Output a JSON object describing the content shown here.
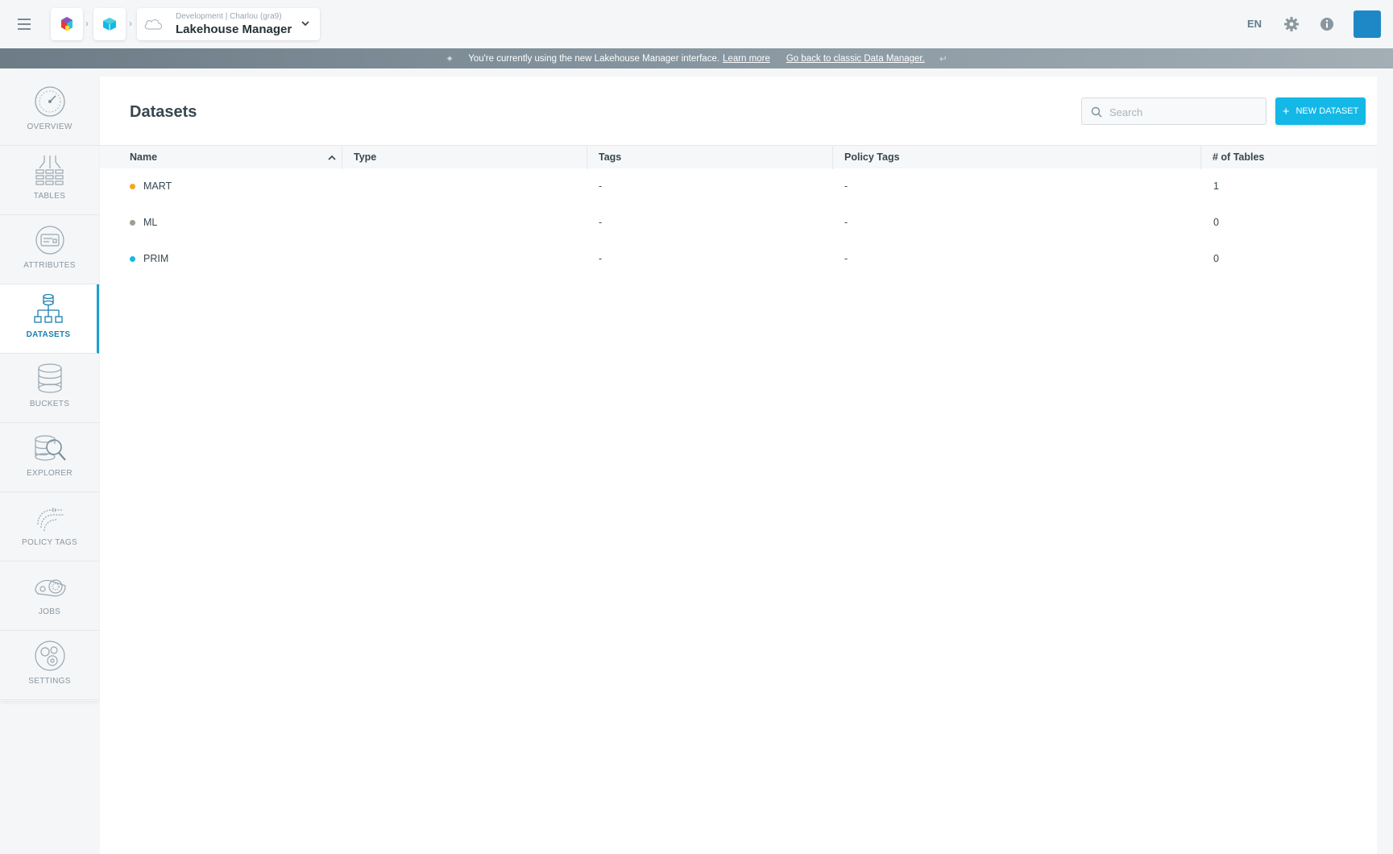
{
  "header": {
    "breadcrumb_sub": "Development | Charlou (gra9)",
    "breadcrumb_title": "Lakehouse Manager",
    "language": "EN"
  },
  "banner": {
    "message": "You're currently using the new Lakehouse Manager interface.",
    "learn_more": "Learn more",
    "go_back": "Go back to classic Data Manager."
  },
  "sidebar": {
    "items": [
      {
        "label": "OVERVIEW",
        "icon": "gauge-icon"
      },
      {
        "label": "TABLES",
        "icon": "tables-icon"
      },
      {
        "label": "ATTRIBUTES",
        "icon": "attributes-icon"
      },
      {
        "label": "DATASETS",
        "icon": "datasets-icon",
        "active": true
      },
      {
        "label": "BUCKETS",
        "icon": "buckets-icon"
      },
      {
        "label": "EXPLORER",
        "icon": "explorer-icon"
      },
      {
        "label": "POLICY TAGS",
        "icon": "policy-tags-icon"
      },
      {
        "label": "JOBS",
        "icon": "jobs-icon"
      },
      {
        "label": "SETTINGS",
        "icon": "settings-icon"
      }
    ]
  },
  "main": {
    "title": "Datasets",
    "search_placeholder": "Search",
    "new_button": "NEW DATASET",
    "columns": [
      "Name",
      "Type",
      "Tags",
      "Policy Tags",
      "# of Tables"
    ],
    "rows": [
      {
        "name": "MART",
        "dot_color": "#f5a623",
        "type": "",
        "tags": "-",
        "policy_tags": "-",
        "tables": "1"
      },
      {
        "name": "ML",
        "dot_color": "#9e9e8e",
        "type": "",
        "tags": "-",
        "policy_tags": "-",
        "tables": "0"
      },
      {
        "name": "PRIM",
        "dot_color": "#14b8e6",
        "type": "",
        "tags": "-",
        "policy_tags": "-",
        "tables": "0"
      }
    ]
  },
  "colors": {
    "accent": "#14b8e6",
    "active_border": "#1a9fd6"
  }
}
